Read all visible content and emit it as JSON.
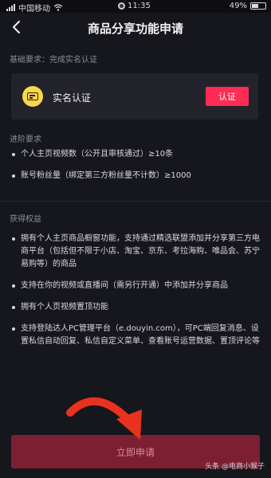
{
  "status_bar": {
    "carrier": "中国移动",
    "time": "11:35",
    "battery": "49%",
    "battery_level": 0.49
  },
  "header": {
    "title": "商品分享功能申请"
  },
  "basic": {
    "label": "基础要求：完成实名认证",
    "card_title": "实名认证",
    "verify_button": "认证"
  },
  "advanced": {
    "label": "进阶要求",
    "items": [
      "个人主页视频数（公开且审核通过）≥10条",
      "账号粉丝量（绑定第三方粉丝量不计数）≥1000"
    ]
  },
  "benefits": {
    "label": "获得权益",
    "items": [
      "拥有个人主页商品橱窗功能，支持通过精选联盟添加并分享第三方电商平台（包括但不限于小店、淘宝、京东、考拉海购、唯品会、苏宁易购等）的商品",
      "支持在你的视频或直播间（需另行开通）中添加并分享商品",
      "拥有个人页视频置顶功能",
      "支持登陆达人PC管理平台（e.douyin.com），可PC端回复消息、设置私信自动回复、私信自定义菜单、查看账号运营数据、置顶评论等"
    ]
  },
  "footer": {
    "apply_button": "立即申请"
  },
  "watermark": "头条 @电商小猴子",
  "colors": {
    "accent": "#fe2c55",
    "apply_disabled": "#7d1f33",
    "background": "#16161d"
  }
}
